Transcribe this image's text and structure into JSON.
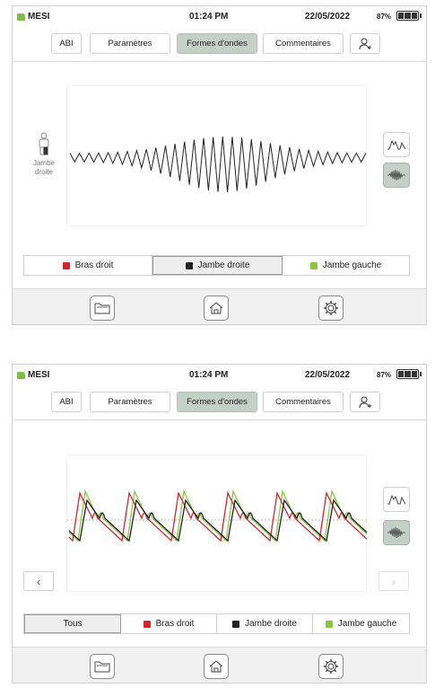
{
  "status": {
    "brand": "MESI",
    "time": "01:24 PM",
    "date": "22/05/2022",
    "battery_pct": "87%"
  },
  "tabs": {
    "abi": "ABI",
    "parametres": "Paramètres",
    "formes_ondes": "Formes d'ondes",
    "commentaires": "Commentaires",
    "active": "formes_ondes"
  },
  "subject": {
    "label_line1": "Jambe",
    "label_line2": "droite"
  },
  "legend_single": {
    "items": [
      {
        "label": "Bras droit",
        "color": "#d9242f"
      },
      {
        "label": "Jambe droite",
        "color": "#222222",
        "active": true
      },
      {
        "label": "Jambe gauche",
        "color": "#8cc63f"
      }
    ]
  },
  "legend_all": {
    "all_label": "Tous",
    "items": [
      {
        "label": "Bras droit",
        "color": "#d9242f"
      },
      {
        "label": "Jambe droite",
        "color": "#222222"
      },
      {
        "label": "Jambe gauche",
        "color": "#8cc63f"
      }
    ]
  },
  "colors": {
    "accent": "#c4cfc8",
    "brand": "#7bbf3a"
  }
}
